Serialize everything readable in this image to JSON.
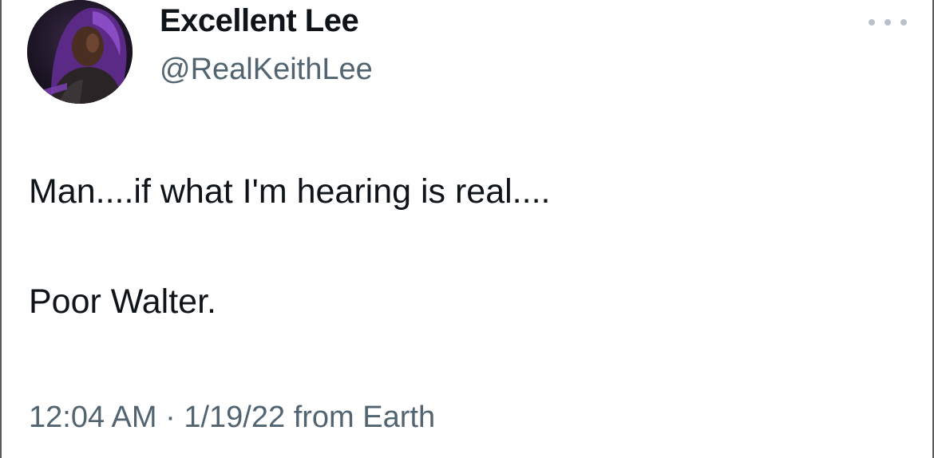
{
  "author": {
    "display_name": "Excellent Lee",
    "handle": "@RealKeithLee",
    "avatar_icon": "profile-photo"
  },
  "actions": {
    "more_icon": "more-horizontal-icon"
  },
  "tweet": {
    "line1": "Man....if what I'm hearing is real....",
    "line2": "Poor Walter.",
    "time": "12:04 AM",
    "separator": " · ",
    "date": "1/19/22",
    "source": " from Earth"
  },
  "colors": {
    "text_primary": "#0f1419",
    "text_secondary": "#536471",
    "dots": "#b9c2ca",
    "avatar_accent": "#7b3fb2"
  }
}
